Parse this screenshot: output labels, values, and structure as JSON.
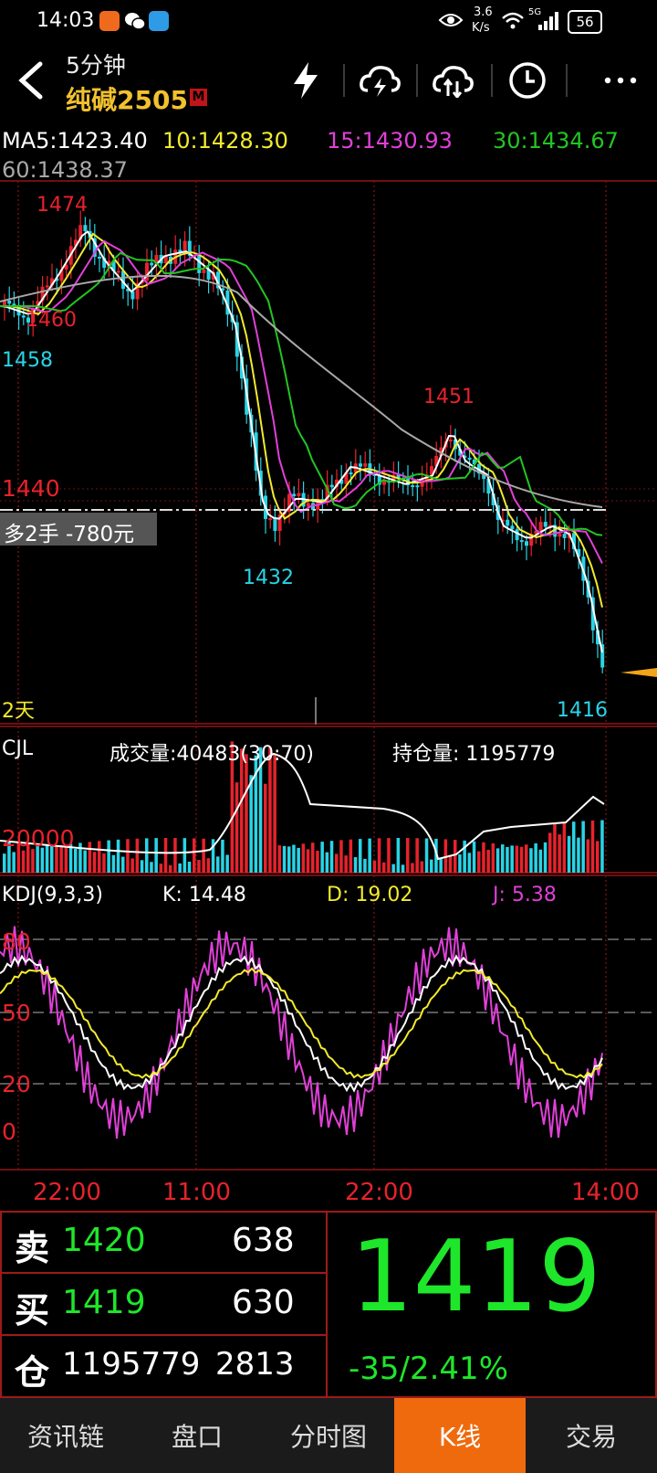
{
  "status": {
    "time": "14:03",
    "net_speed_top": "3.6",
    "net_speed_bottom": "K/s",
    "signal_label": "5G",
    "battery": "56"
  },
  "header": {
    "period": "5分钟",
    "contract": "纯碱2505",
    "badge": "M"
  },
  "ma": {
    "ma5": "MA5:1423.40",
    "ma10": "10:1428.30",
    "ma15": "15:1430.93",
    "ma30": "30:1434.67",
    "ma60": "60:1438.37"
  },
  "colors": {
    "up": "#e8222c",
    "down": "#29d4e6",
    "ma5": "#ffffff",
    "ma10": "#f2ea2e",
    "ma15": "#e040d8",
    "ma30": "#22c522",
    "ma60": "#a8a8a8",
    "accent": "#ef6a0c",
    "price_green": "#1ee62a"
  },
  "main_chart": {
    "label_1474": "1474",
    "label_1460": "1460",
    "label_1458": "1458",
    "label_1451": "1451",
    "label_1440": "1440",
    "label_1432": "1432",
    "label_1416": "1416",
    "position_note": "多2手  -780元",
    "period_label": "2天"
  },
  "volume": {
    "title": "CJL",
    "volume_text": "成交量:40483(30:70)",
    "oi_text": "持仓量: 1195779",
    "axis_label": "20000"
  },
  "kdj": {
    "title": "KDJ(9,3,3)",
    "k": "K: 14.48",
    "d": "D: 19.02",
    "j": "J: 5.38",
    "tick_80": "80",
    "tick_50": "50",
    "tick_20": "20",
    "tick_0": "0"
  },
  "time_axis": [
    "22:00",
    "11:00",
    "22:00",
    "14:00"
  ],
  "quote": {
    "sell_label": "卖",
    "sell_price": "1420",
    "sell_vol": "638",
    "buy_label": "买",
    "buy_price": "1419",
    "buy_vol": "630",
    "oi_label": "仓",
    "oi_value": "1195779",
    "oi_change": "2813",
    "last_price": "1419",
    "change": "-35/2.41%"
  },
  "nav": [
    "资讯链",
    "盘口",
    "分时图",
    "K线",
    "交易"
  ]
}
